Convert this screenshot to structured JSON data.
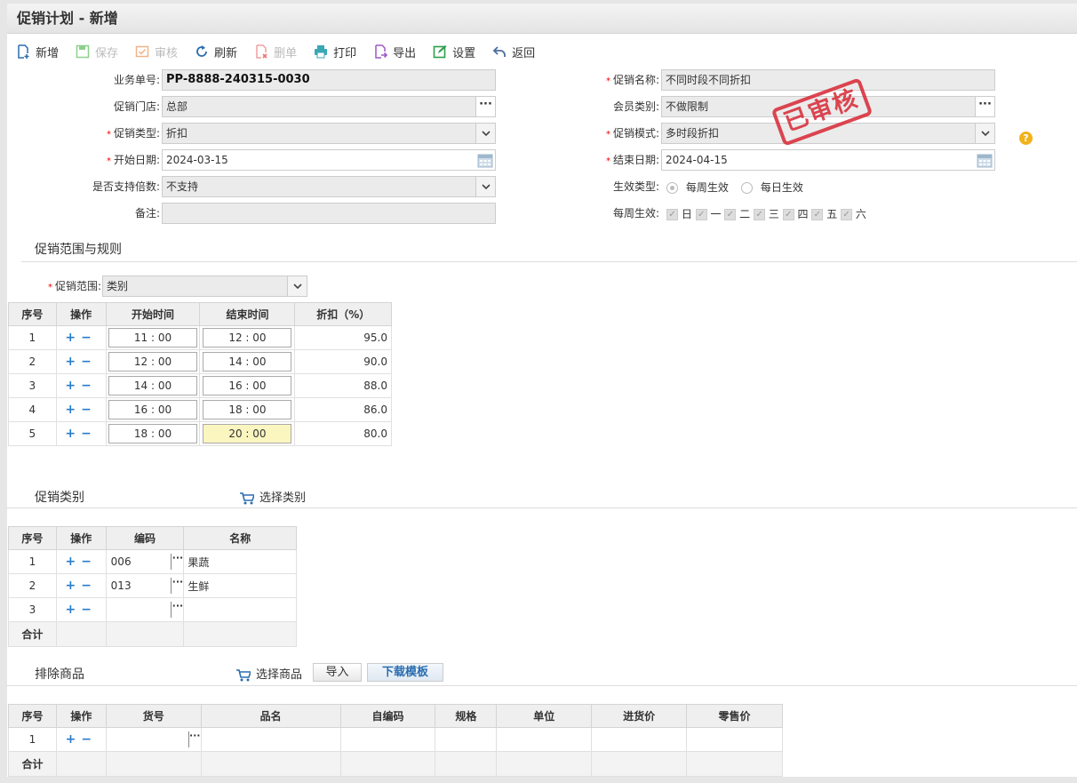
{
  "title": "促销计划 - 新增",
  "toolbar": {
    "add": "新增",
    "save": "保存",
    "audit": "审核",
    "refresh": "刷新",
    "delete": "删单",
    "print": "打印",
    "export": "导出",
    "settings": "设置",
    "back": "返回"
  },
  "form": {
    "order_no_label": "业务单号:",
    "order_no": "PP-8888-240315-0030",
    "name_label": "促销名称:",
    "name": "不同时段不同折扣",
    "store_label": "促销门店:",
    "store": "总部",
    "member_label": "会员类别:",
    "member": "不做限制",
    "type_label": "促销类型:",
    "type": "折扣",
    "mode_label": "促销模式:",
    "mode": "多时段折扣",
    "start_label": "开始日期:",
    "start": "2024-03-15",
    "end_label": "结束日期:",
    "end": "2024-04-15",
    "multiple_label": "是否支持倍数:",
    "multiple": "不支持",
    "effect_label": "生效类型:",
    "effect_weekly": "每周生效",
    "effect_daily": "每日生效",
    "remark_label": "备注:",
    "remark": "",
    "weekly_label": "每周生效:",
    "weekdays": [
      "日",
      "一",
      "二",
      "三",
      "四",
      "五",
      "六"
    ]
  },
  "stamp": "已审核",
  "rules": {
    "section": "促销范围与规则",
    "scope_label": "促销范围:",
    "scope": "类别",
    "headers": [
      "序号",
      "操作",
      "开始时间",
      "结束时间",
      "折扣（%）"
    ],
    "rows": [
      {
        "no": "1",
        "start": "11 : 00",
        "end": "12 : 00",
        "discount": "95.0"
      },
      {
        "no": "2",
        "start": "12 : 00",
        "end": "14 : 00",
        "discount": "90.0"
      },
      {
        "no": "3",
        "start": "14 : 00",
        "end": "16 : 00",
        "discount": "88.0"
      },
      {
        "no": "4",
        "start": "16 : 00",
        "end": "18 : 00",
        "discount": "86.0"
      },
      {
        "no": "5",
        "start": "18 : 00",
        "end": "20 : 00",
        "discount": "80.0"
      }
    ]
  },
  "categories": {
    "section": "促销类别",
    "select": "选择类别",
    "headers": [
      "序号",
      "操作",
      "编码",
      "名称"
    ],
    "rows": [
      {
        "no": "1",
        "code": "006",
        "name": "果蔬"
      },
      {
        "no": "2",
        "code": "013",
        "name": "生鲜"
      },
      {
        "no": "3",
        "code": "",
        "name": ""
      }
    ],
    "total": "合计"
  },
  "exclude": {
    "section": "排除商品",
    "select": "选择商品",
    "import": "导入",
    "download": "下载模板",
    "headers": [
      "序号",
      "操作",
      "货号",
      "品名",
      "自编码",
      "规格",
      "单位",
      "进货价",
      "零售价"
    ],
    "rows": [
      {
        "no": "1"
      }
    ],
    "total": "合计"
  },
  "colors": {
    "required": "#e00000",
    "stamp": "#d9333f",
    "accent": "#2a7cc7",
    "help": "#f2b21d"
  }
}
